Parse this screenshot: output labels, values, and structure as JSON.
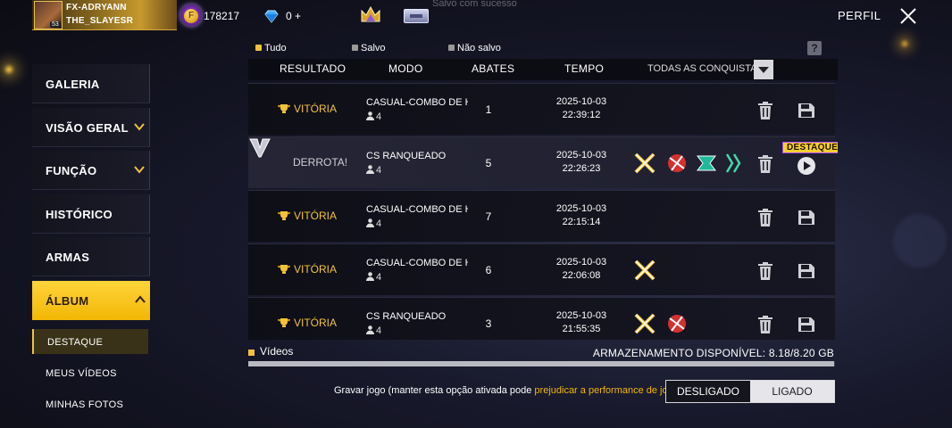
{
  "topbar": {
    "player_name_line1": "FX-ADRYANN",
    "player_name_line2": "THE_SLAYESR",
    "level": "53",
    "coins": "178217",
    "diamonds": "0 +",
    "toast": "Salvo com sucesso",
    "profile_label": "PERFIL"
  },
  "sidebar": {
    "items": [
      {
        "label": "GALERIA"
      },
      {
        "label": "VISÃO GERAL"
      },
      {
        "label": "FUNÇÃO"
      },
      {
        "label": "HISTÓRICO"
      },
      {
        "label": "ARMAS"
      },
      {
        "label": "ÁLBUM"
      }
    ],
    "sub_items": [
      {
        "label": "DESTAQUE"
      },
      {
        "label": "MEUS VÍDEOS"
      },
      {
        "label": "MINHAS FOTOS"
      }
    ]
  },
  "filters": {
    "all": "Tudo",
    "saved": "Salvo",
    "unsaved": "Não salvo",
    "help": "?"
  },
  "table": {
    "headers": {
      "result": "RESULTADO",
      "mode": "MODO",
      "kills": "ABATES",
      "time": "TEMPO",
      "achievements": "TODAS AS CONQUISTAS"
    },
    "rows": [
      {
        "result": "VITÓRIA",
        "mode": "CASUAL-COMBO DE HABILIDADES",
        "players": "4",
        "kills": "1",
        "date": "2025-10-03",
        "time": "22:39:12"
      },
      {
        "result": "DERROTA!",
        "mode": "CS RANQUEADO",
        "players": "4",
        "kills": "5",
        "date": "2025-10-03",
        "time": "22:26:23",
        "tag": "DESTAQUE"
      },
      {
        "result": "VITÓRIA",
        "mode": "CASUAL-COMBO DE HABILIDADES",
        "players": "4",
        "kills": "7",
        "date": "2025-10-03",
        "time": "22:15:14"
      },
      {
        "result": "VITÓRIA",
        "mode": "CASUAL-COMBO DE HABILIDADES",
        "players": "4",
        "kills": "6",
        "date": "2025-10-03",
        "time": "22:06:08"
      },
      {
        "result": "VITÓRIA",
        "mode": "CS RANQUEADO",
        "players": "4",
        "kills": "3",
        "date": "2025-10-03",
        "time": "21:55:35"
      }
    ]
  },
  "storage": {
    "label": "Vídeos",
    "text": "ARMAZENAMENTO DISPONÍVEL: 8.18/8.20 GB",
    "used_fraction": 0.998
  },
  "record": {
    "text_before": "Gravar jogo (manter esta opção ativada pode ",
    "link": "prejudicar a performance de jogo",
    "text_after": ").",
    "off_label": "DESLIGADO",
    "on_label": "LIGADO"
  },
  "colors": {
    "accent": "#f2c33a",
    "active_tab": "#ffd43b"
  }
}
